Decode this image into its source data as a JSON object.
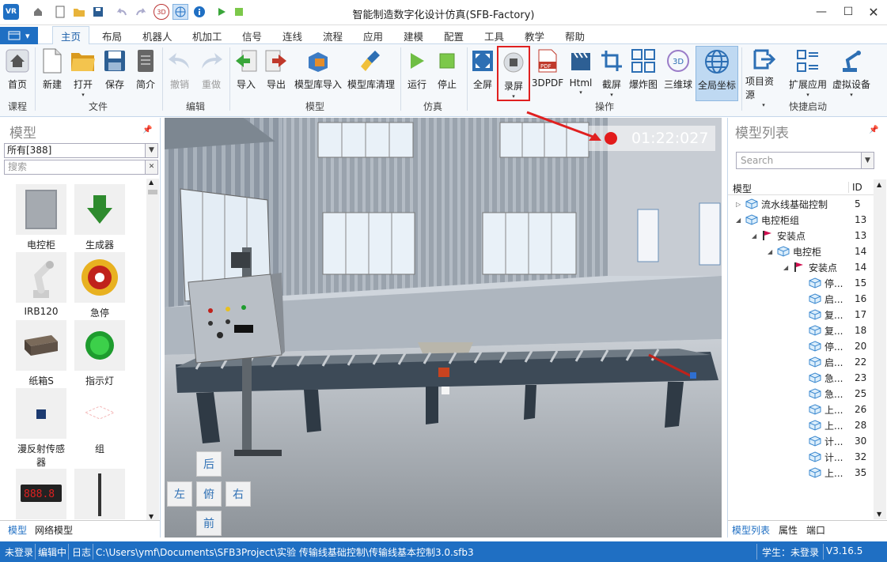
{
  "window": {
    "title": "智能制造数字化设计仿真(SFB-Factory)"
  },
  "menu": {
    "tabs": [
      "主页",
      "布局",
      "机器人",
      "机加工",
      "信号",
      "连线",
      "流程",
      "应用",
      "建模",
      "配置",
      "工具",
      "教学",
      "帮助"
    ],
    "active": "主页"
  },
  "ribbon": {
    "buttons": {
      "home": "首页",
      "new": "新建",
      "open": "打开",
      "save": "保存",
      "brief": "简介",
      "undo": "撤销",
      "redo": "重做",
      "import": "导入",
      "export": "导出",
      "lib_import": "模型库导入",
      "lib_clean": "模型库清理",
      "run": "运行",
      "stop": "停止",
      "fullscreen": "全屏",
      "record": "录屏",
      "pdf3d": "3DPDF",
      "html": "Html",
      "screenshot": "截屏",
      "explode": "爆炸图",
      "ball3d": "三维球",
      "global_coord": "全局坐标",
      "project_res": "项目资源",
      "ext_app": "扩展应用",
      "virtual_dev": "虚拟设备"
    },
    "groups": {
      "course": "课程",
      "file": "文件",
      "edit": "编辑",
      "model": "模型",
      "sim": "仿真",
      "ops": "操作",
      "quick": "快捷启动"
    }
  },
  "left_panel": {
    "title": "模型",
    "filter": "所有[388]",
    "search_placeholder": "搜索",
    "items": [
      "电控柜",
      "生成器",
      "IRB120",
      "急停",
      "纸箱S",
      "指示灯",
      "漫反射传感器",
      "组"
    ],
    "tabs": [
      "模型",
      "网络模型"
    ]
  },
  "viewport": {
    "timer": "01:22:027",
    "nav": {
      "back": "后",
      "left": "左",
      "top": "俯",
      "right": "右",
      "front": "前"
    }
  },
  "right_panel": {
    "title": "模型列表",
    "search_placeholder": "Search",
    "col_model": "模型",
    "col_id": "ID",
    "tree": [
      {
        "label": "流水线基础控制",
        "id": "5"
      },
      {
        "label": "电控柜组",
        "id": "13"
      },
      {
        "label": "安装点",
        "id": "13"
      },
      {
        "label": "电控柜",
        "id": "14"
      },
      {
        "label": "安装点",
        "id": "14"
      },
      {
        "label": "停...",
        "id": "15"
      },
      {
        "label": "启...",
        "id": "16"
      },
      {
        "label": "复...",
        "id": "17"
      },
      {
        "label": "复...",
        "id": "18"
      },
      {
        "label": "停...",
        "id": "20"
      },
      {
        "label": "启...",
        "id": "22"
      },
      {
        "label": "急...",
        "id": "23"
      },
      {
        "label": "急...",
        "id": "25"
      },
      {
        "label": "上...",
        "id": "26"
      },
      {
        "label": "上...",
        "id": "28"
      },
      {
        "label": "计...",
        "id": "30"
      },
      {
        "label": "计...",
        "id": "32"
      },
      {
        "label": "上...",
        "id": "35"
      }
    ],
    "tabs": [
      "模型列表",
      "属性",
      "端口"
    ]
  },
  "status": {
    "login": "未登录",
    "mode": "编辑中",
    "log": "日志",
    "path": "C:\\Users\\ymf\\Documents\\SFB3Project\\实验 传输线基础控制\\传输线基本控制3.0.sfb3",
    "student": "学生：未登录",
    "version": "V3.16.5"
  },
  "colors": {
    "accent": "#1f6fc3",
    "record_red": "#e21b1b",
    "highlight": "#e02020"
  }
}
